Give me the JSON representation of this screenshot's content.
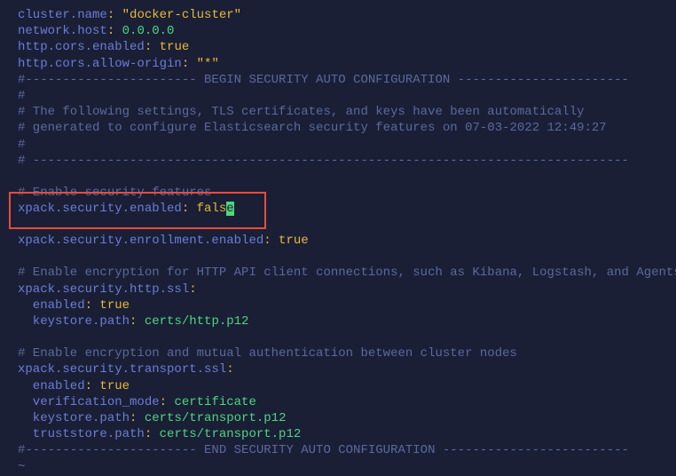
{
  "lines": {
    "l1_key": "cluster.name",
    "l1_colon": ":",
    "l1_val": " \"docker-cluster\"",
    "l2_key": "network.host",
    "l2_colon": ":",
    "l2_val": " 0.0.0.0",
    "l3_key": "http.cors.enabled",
    "l3_colon": ":",
    "l3_val": " true",
    "l4_key": "http.cors.allow-origin",
    "l4_colon": ":",
    "l4_val": " \"*\"",
    "l5": "#----------------------- BEGIN SECURITY AUTO CONFIGURATION -----------------------",
    "l6": "#",
    "l7": "# The following settings, TLS certificates, and keys have been automatically",
    "l8": "# generated to configure Elasticsearch security features on 07-03-2022 12:49:27",
    "l9": "#",
    "l10": "# --------------------------------------------------------------------------------",
    "l11": "",
    "l12": "# Enable security features",
    "l13_key": "xpack.security.enabled",
    "l13_colon": ":",
    "l13_val_pre": " fals",
    "l13_cursor": "e",
    "l14": "",
    "l15_key": "xpack.security.enrollment.enabled",
    "l15_colon": ":",
    "l15_val": " true",
    "l16": "",
    "l17": "# Enable encryption for HTTP API client connections, such as Kibana, Logstash, and Agents",
    "l18_key": "xpack.security.http.ssl",
    "l18_colon": ":",
    "l19_key": "  enabled",
    "l19_colon": ":",
    "l19_val": " true",
    "l20_key": "  keystore.path",
    "l20_colon": ":",
    "l20_val": " certs/http.p12",
    "l21": "",
    "l22": "# Enable encryption and mutual authentication between cluster nodes",
    "l23_key": "xpack.security.transport.ssl",
    "l23_colon": ":",
    "l24_key": "  enabled",
    "l24_colon": ":",
    "l24_val": " true",
    "l25_key": "  verification_mode",
    "l25_colon": ":",
    "l25_val": " certificate",
    "l26_key": "  keystore.path",
    "l26_colon": ":",
    "l26_val": " certs/transport.p12",
    "l27_key": "  truststore.path",
    "l27_colon": ":",
    "l27_val": " certs/transport.p12",
    "l28": "#----------------------- END SECURITY AUTO CONFIGURATION -------------------------",
    "l29": "~"
  }
}
